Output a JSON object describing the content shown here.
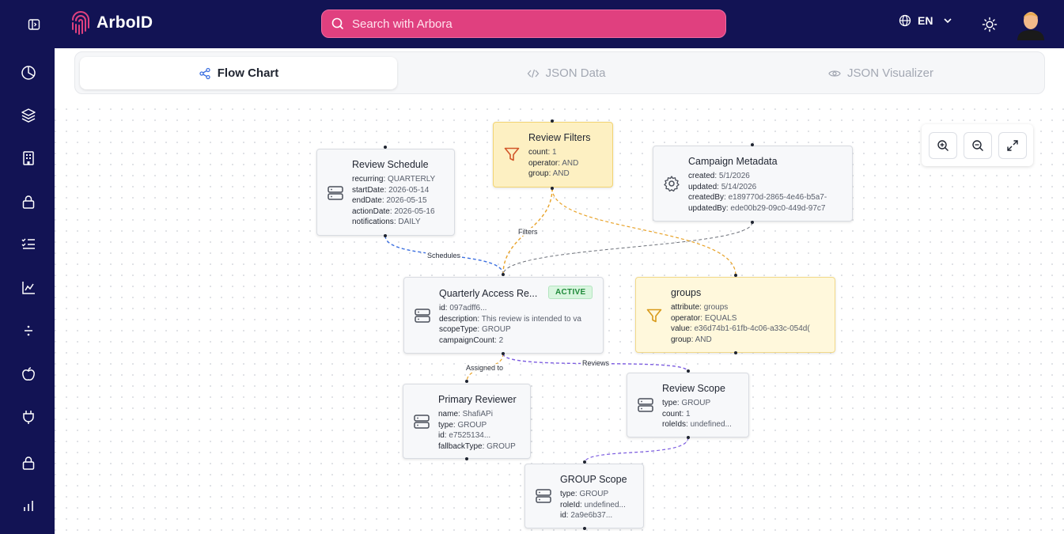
{
  "header": {
    "app_name": "ArboID",
    "search_placeholder": "Search with Arbora",
    "language": "EN"
  },
  "sidebar": {
    "items": [
      {
        "icon": "pie-chart-icon"
      },
      {
        "icon": "layers-icon"
      },
      {
        "icon": "building-icon"
      },
      {
        "icon": "lock-icon"
      },
      {
        "icon": "checklist-icon"
      },
      {
        "icon": "line-chart-icon"
      },
      {
        "icon": "divide-icon"
      },
      {
        "icon": "apple-icon"
      },
      {
        "icon": "plug-icon"
      },
      {
        "icon": "lock-icon"
      },
      {
        "icon": "bar-chart-icon"
      }
    ]
  },
  "tabs": [
    {
      "label": "Flow Chart",
      "icon": "share-icon",
      "active": true
    },
    {
      "label": "JSON Data",
      "icon": "code-icon",
      "active": false
    },
    {
      "label": "JSON Visualizer",
      "icon": "eye-icon",
      "active": false
    }
  ],
  "colors": {
    "navy": "#121354",
    "pink": "#e0407f",
    "edge_blue": "#3b6fe0",
    "edge_orange": "#e8a227",
    "edge_gray": "#6b6f78",
    "edge_purple": "#7c5ce0",
    "status_green": "#1f8a3a"
  },
  "nodes": {
    "schedule": {
      "title": "Review Schedule",
      "fields": [
        {
          "k": "recurring",
          "v": "QUARTERLY"
        },
        {
          "k": "startDate",
          "v": "2026-05-14"
        },
        {
          "k": "endDate",
          "v": "2026-05-15"
        },
        {
          "k": "actionDate",
          "v": "2026-05-16"
        },
        {
          "k": "notifications",
          "v": "DAILY"
        }
      ]
    },
    "filters": {
      "title": "Review Filters",
      "fields": [
        {
          "k": "count",
          "v": "1"
        },
        {
          "k": "operator",
          "v": "AND"
        },
        {
          "k": "group",
          "v": "AND"
        }
      ]
    },
    "metadata": {
      "title": "Campaign Metadata",
      "fields": [
        {
          "k": "created",
          "v": "5/1/2026"
        },
        {
          "k": "updated",
          "v": "5/14/2026"
        },
        {
          "k": "createdBy",
          "v": "e189770d-2865-4e46-b5a7-"
        },
        {
          "k": "updatedBy",
          "v": "ede00b29-09c0-449d-97c7"
        }
      ]
    },
    "main": {
      "title": "Quarterly Access Re...",
      "status": "ACTIVE",
      "fields": [
        {
          "k": "id",
          "v": "097adff6..."
        },
        {
          "k": "description",
          "v": "This review is intended to va"
        },
        {
          "k": "scopeType",
          "v": "GROUP"
        },
        {
          "k": "campaignCount",
          "v": "2"
        }
      ]
    },
    "groups": {
      "title": "groups",
      "fields": [
        {
          "k": "attribute",
          "v": "groups"
        },
        {
          "k": "operator",
          "v": "EQUALS"
        },
        {
          "k": "value",
          "v": "e36d74b1-61fb-4c06-a33c-054d("
        },
        {
          "k": "group",
          "v": "AND"
        }
      ]
    },
    "reviewer": {
      "title": "Primary Reviewer",
      "fields": [
        {
          "k": "name",
          "v": "ShafiAPi"
        },
        {
          "k": "type",
          "v": "GROUP"
        },
        {
          "k": "id",
          "v": "e7525134..."
        },
        {
          "k": "fallbackType",
          "v": "GROUP"
        }
      ]
    },
    "scope": {
      "title": "Review Scope",
      "fields": [
        {
          "k": "type",
          "v": "GROUP"
        },
        {
          "k": "count",
          "v": "1"
        },
        {
          "k": "roleIds",
          "v": "undefined..."
        }
      ]
    },
    "group_scope": {
      "title": "GROUP Scope",
      "fields": [
        {
          "k": "type",
          "v": "GROUP"
        },
        {
          "k": "roleId",
          "v": "undefined..."
        },
        {
          "k": "id",
          "v": "2a9e6b37..."
        }
      ]
    }
  },
  "edge_labels": {
    "schedules": "Schedules",
    "filters": "Filters",
    "assigned_to": "Assigned to",
    "reviews": "Reviews"
  },
  "zoom_controls": [
    "zoom-in-icon",
    "zoom-out-icon",
    "fullscreen-icon"
  ]
}
